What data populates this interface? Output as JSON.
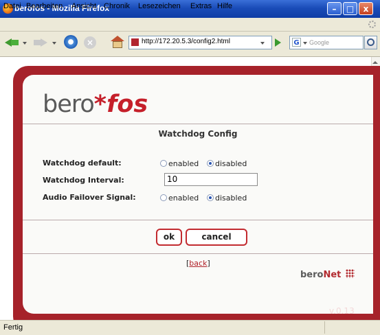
{
  "window": {
    "title": "berofos - Mozilla Firefox",
    "controls": {
      "minimize": "–",
      "maximize": "□",
      "close": "x"
    }
  },
  "menubar": {
    "items": [
      "Datei",
      "Bearbeiten",
      "Ansicht",
      "Chronik",
      "Lesezeichen",
      "Extras",
      "Hilfe"
    ]
  },
  "toolbar": {
    "url": "http://172.20.5.3/config2.html",
    "search_placeholder": "Google",
    "search_engine_icon": "G",
    "stop_glyph": "×",
    "icons": [
      "back-arrow-icon",
      "forward-arrow-icon",
      "reload-icon",
      "stop-icon",
      "home-icon",
      "go-arrow-icon",
      "search-magnifier-icon"
    ]
  },
  "page": {
    "logo": {
      "part1": "bero",
      "star": "*",
      "part2": "fos"
    },
    "title": "Watchdog Config",
    "form": {
      "watchdog_default": {
        "label": "Watchdog default:",
        "options": [
          "enabled",
          "disabled"
        ],
        "selected": "disabled"
      },
      "watchdog_interval": {
        "label": "Watchdog Interval:",
        "value": "10"
      },
      "audio_failover": {
        "label": "Audio Failover Signal:",
        "options": [
          "enabled",
          "disabled"
        ],
        "selected": "disabled"
      }
    },
    "buttons": {
      "ok": "ok",
      "cancel": "cancel"
    },
    "back_link": {
      "open": "[",
      "label": "back",
      "close": "]"
    },
    "footer_logo": {
      "part1": "bero",
      "part2": "Net"
    },
    "version": "v.0.13"
  },
  "status_bar": {
    "text": "Fertig"
  },
  "colors": {
    "brand_red": "#a6222a",
    "accent_red": "#c51f2a",
    "titlebar_blue": "#1a4cb8"
  }
}
